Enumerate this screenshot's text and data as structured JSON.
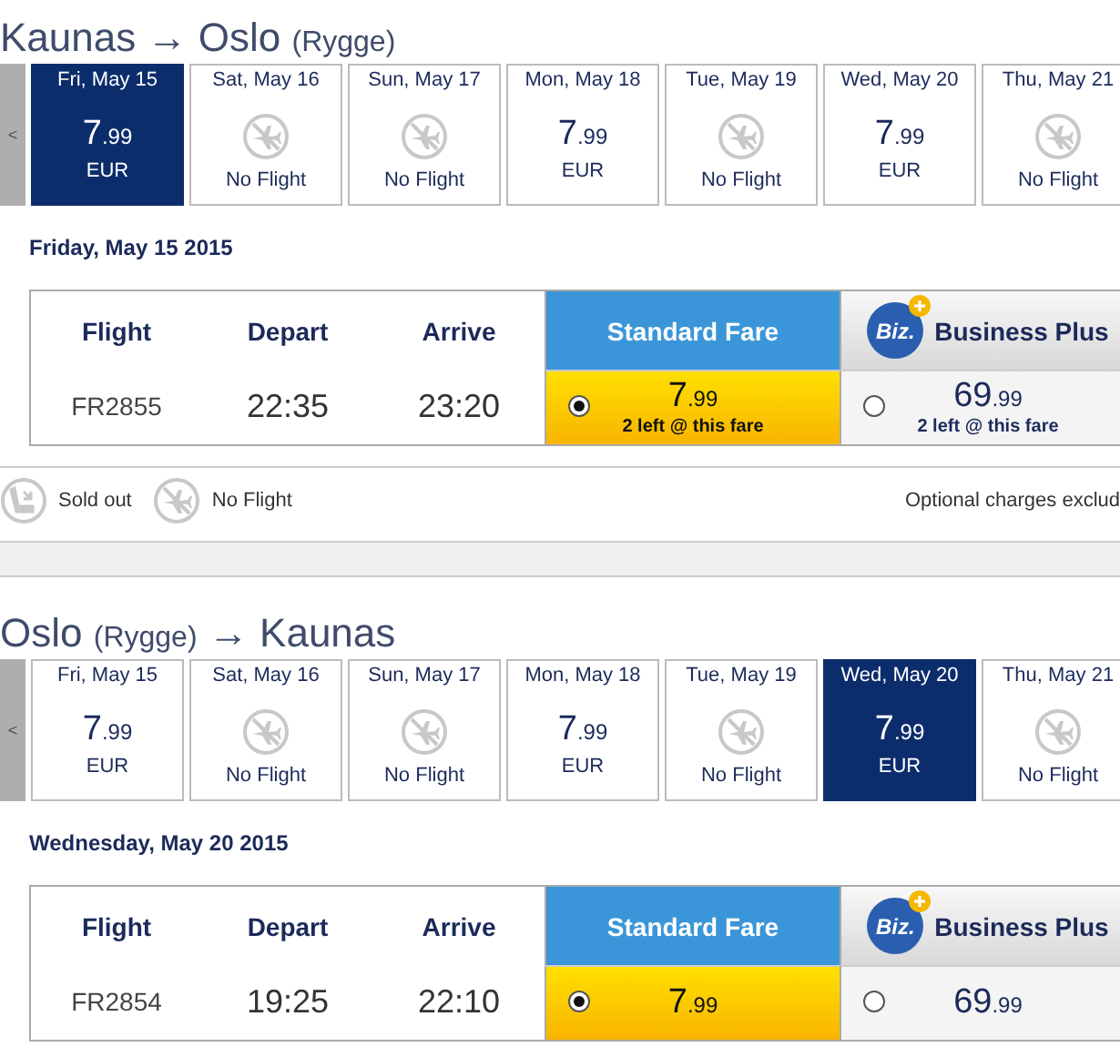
{
  "outbound": {
    "title": {
      "from": "Kaunas",
      "arrow": "→",
      "to": "Oslo",
      "to_note": "(Rygge)"
    },
    "prev_label": "<",
    "days": [
      {
        "day": "Fri, May 15",
        "kind": "fare",
        "price_main": "7",
        "price_cents": ".99",
        "currency": "EUR",
        "selected": true
      },
      {
        "day": "Sat, May 16",
        "kind": "no_flight",
        "note": "No Flight",
        "selected": false
      },
      {
        "day": "Sun, May 17",
        "kind": "no_flight",
        "note": "No Flight",
        "selected": false
      },
      {
        "day": "Mon, May 18",
        "kind": "fare",
        "price_main": "7",
        "price_cents": ".99",
        "currency": "EUR",
        "selected": false
      },
      {
        "day": "Tue, May 19",
        "kind": "no_flight",
        "note": "No Flight",
        "selected": false
      },
      {
        "day": "Wed, May 20",
        "kind": "fare",
        "price_main": "7",
        "price_cents": ".99",
        "currency": "EUR",
        "selected": false
      },
      {
        "day": "Thu, May 21",
        "kind": "no_flight",
        "note": "No Flight",
        "selected": false
      }
    ],
    "date_label": "Friday, May 15 2015",
    "columns": [
      "Flight",
      "Depart",
      "Arrive"
    ],
    "flight": {
      "number": "FR2855",
      "depart": "22:35",
      "arrive": "23:20"
    },
    "fares": [
      {
        "kind": "standard",
        "name": "Standard Fare",
        "selected": true,
        "price_main": "7",
        "price_cents": ".99",
        "availability": "2 left @ this fare"
      },
      {
        "kind": "business",
        "name": "Business Plus",
        "logo_text": "Biz.",
        "selected": false,
        "price_main": "69",
        "price_cents": ".99",
        "availability": "2 left @ this fare"
      }
    ]
  },
  "legend": {
    "items": [
      {
        "kind": "sold_out",
        "label": "Sold out"
      },
      {
        "kind": "no_flight",
        "label": "No Flight"
      }
    ],
    "note": "Optional charges exclud"
  },
  "inbound": {
    "title": {
      "from": "Oslo",
      "from_note": "(Rygge)",
      "arrow": "→",
      "to": "Kaunas"
    },
    "prev_label": "<",
    "days": [
      {
        "day": "Fri, May 15",
        "kind": "fare",
        "price_main": "7",
        "price_cents": ".99",
        "currency": "EUR",
        "selected": false
      },
      {
        "day": "Sat, May 16",
        "kind": "no_flight",
        "note": "No Flight",
        "selected": false
      },
      {
        "day": "Sun, May 17",
        "kind": "no_flight",
        "note": "No Flight",
        "selected": false
      },
      {
        "day": "Mon, May 18",
        "kind": "fare",
        "price_main": "7",
        "price_cents": ".99",
        "currency": "EUR",
        "selected": false
      },
      {
        "day": "Tue, May 19",
        "kind": "no_flight",
        "note": "No Flight",
        "selected": false
      },
      {
        "day": "Wed, May 20",
        "kind": "fare",
        "price_main": "7",
        "price_cents": ".99",
        "currency": "EUR",
        "selected": true
      },
      {
        "day": "Thu, May 21",
        "kind": "no_flight",
        "note": "No Flight",
        "selected": false
      }
    ],
    "date_label": "Wednesday, May 20 2015",
    "columns": [
      "Flight",
      "Depart",
      "Arrive"
    ],
    "flight": {
      "number": "FR2854",
      "depart": "19:25",
      "arrive": "22:10"
    },
    "fares": [
      {
        "kind": "standard",
        "name": "Standard Fare",
        "selected": true,
        "price_main": "7",
        "price_cents": ".99"
      },
      {
        "kind": "business",
        "name": "Business Plus",
        "logo_text": "Biz.",
        "selected": false,
        "price_main": "69",
        "price_cents": ".99"
      }
    ]
  }
}
